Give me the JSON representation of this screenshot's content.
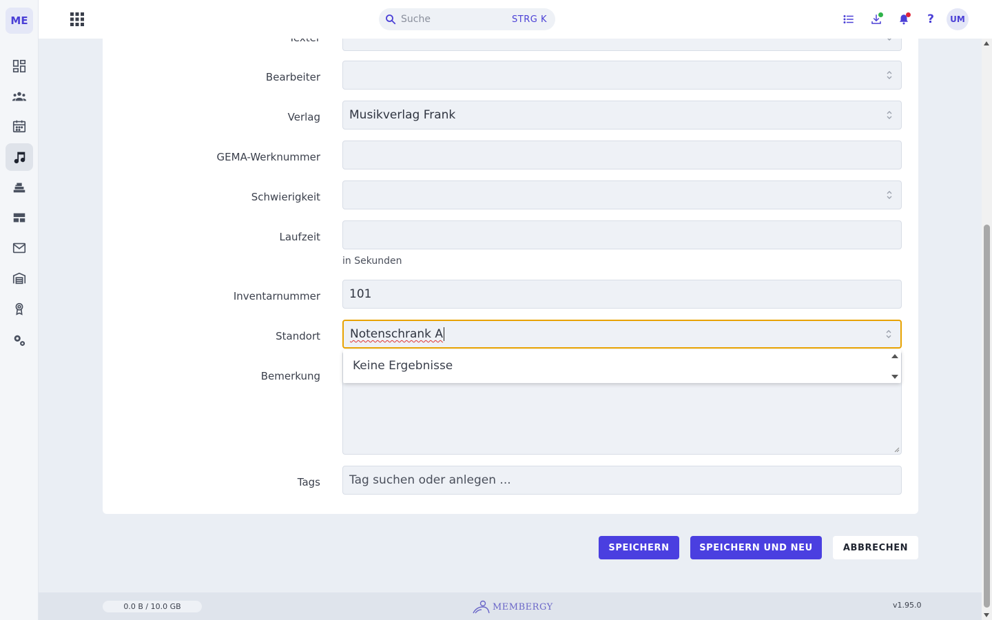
{
  "app": {
    "logo": "ME"
  },
  "sidebar": {
    "items": [
      {
        "icon": "dashboard-icon"
      },
      {
        "icon": "members-icon"
      },
      {
        "icon": "calendar-icon"
      },
      {
        "icon": "music-note-icon",
        "active": true
      },
      {
        "icon": "inventory-icon"
      },
      {
        "icon": "table-icon"
      },
      {
        "icon": "mail-icon"
      },
      {
        "icon": "warehouse-icon"
      },
      {
        "icon": "award-icon"
      },
      {
        "icon": "settings-icon"
      }
    ]
  },
  "topbar": {
    "search_placeholder": "Suche",
    "search_shortcut": "STRG K",
    "avatar": "UM",
    "colors": {
      "accent": "#4a3fd6",
      "download_dot": "#2fb34a",
      "notification_dot": "#e0243a"
    }
  },
  "form": {
    "fields": {
      "texter": {
        "label": "Texter",
        "value": ""
      },
      "bearbeiter": {
        "label": "Bearbeiter",
        "value": ""
      },
      "verlag": {
        "label": "Verlag",
        "value": "Musikverlag Frank"
      },
      "gema": {
        "label": "GEMA-Werknummer",
        "value": ""
      },
      "schwierigkeit": {
        "label": "Schwierigkeit",
        "value": ""
      },
      "laufzeit": {
        "label": "Laufzeit",
        "value": "",
        "hint": "in Sekunden"
      },
      "inventarnummer": {
        "label": "Inventarnummer",
        "value": "101"
      },
      "standort": {
        "label": "Standort",
        "value": "Notenschrank A"
      },
      "bemerkung": {
        "label": "Bemerkung",
        "value": ""
      },
      "tags": {
        "label": "Tags",
        "placeholder": "Tag suchen oder anlegen ..."
      }
    },
    "dropdown": {
      "text": "Keine Ergebnisse"
    },
    "buttons": {
      "save": "SPEICHERN",
      "save_new": "SPEICHERN UND NEU",
      "cancel": "ABBRECHEN"
    }
  },
  "footer": {
    "storage": "0.0 B / 10.0 GB",
    "brand": "MEMBERGY",
    "version": "v1.95.0"
  }
}
